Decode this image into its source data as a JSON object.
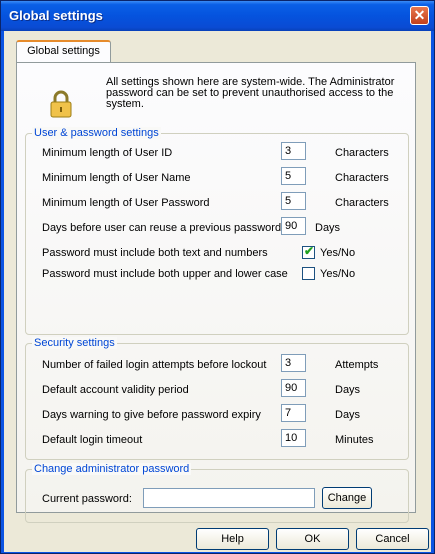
{
  "window": {
    "title": "Global settings",
    "close_glyph": "✕"
  },
  "tab": {
    "label": "Global settings"
  },
  "intro": {
    "icon": "lock-icon",
    "text": "All settings shown here are system-wide. The Administrator password can be set to prevent unauthorised access to the system."
  },
  "user_pw": {
    "legend": "User & password settings",
    "rows": [
      {
        "label": "Minimum length of User ID",
        "value": "3",
        "unit": "Characters"
      },
      {
        "label": "Minimum length of User Name",
        "value": "5",
        "unit": "Characters"
      },
      {
        "label": "Minimum length of User Password",
        "value": "5",
        "unit": "Characters"
      },
      {
        "label": "Days before user can reuse a previous password",
        "value": "90",
        "unit": "Days"
      }
    ],
    "checks": [
      {
        "label": "Password must include both text and numbers",
        "checked": true,
        "unit": "Yes/No"
      },
      {
        "label": "Password must include both upper and lower case",
        "checked": false,
        "unit": "Yes/No"
      }
    ]
  },
  "security": {
    "legend": "Security settings",
    "rows": [
      {
        "label": "Number of failed login attempts before lockout",
        "value": "3",
        "unit": "Attempts"
      },
      {
        "label": "Default account validity period",
        "value": "90",
        "unit": "Days"
      },
      {
        "label": "Days warning to give before password expiry",
        "value": "7",
        "unit": "Days"
      },
      {
        "label": "Default login timeout",
        "value": "10",
        "unit": "Minutes"
      }
    ]
  },
  "admin": {
    "legend": "Change administrator password",
    "current_label": "Current password:",
    "current_value": "",
    "change_label": "Change"
  },
  "buttons": {
    "help": "Help",
    "ok": "OK",
    "cancel": "Cancel"
  },
  "colors": {
    "titlebar": "#0553de",
    "legend": "#0046d5",
    "client": "#ece9d8",
    "check": "#21a121"
  }
}
